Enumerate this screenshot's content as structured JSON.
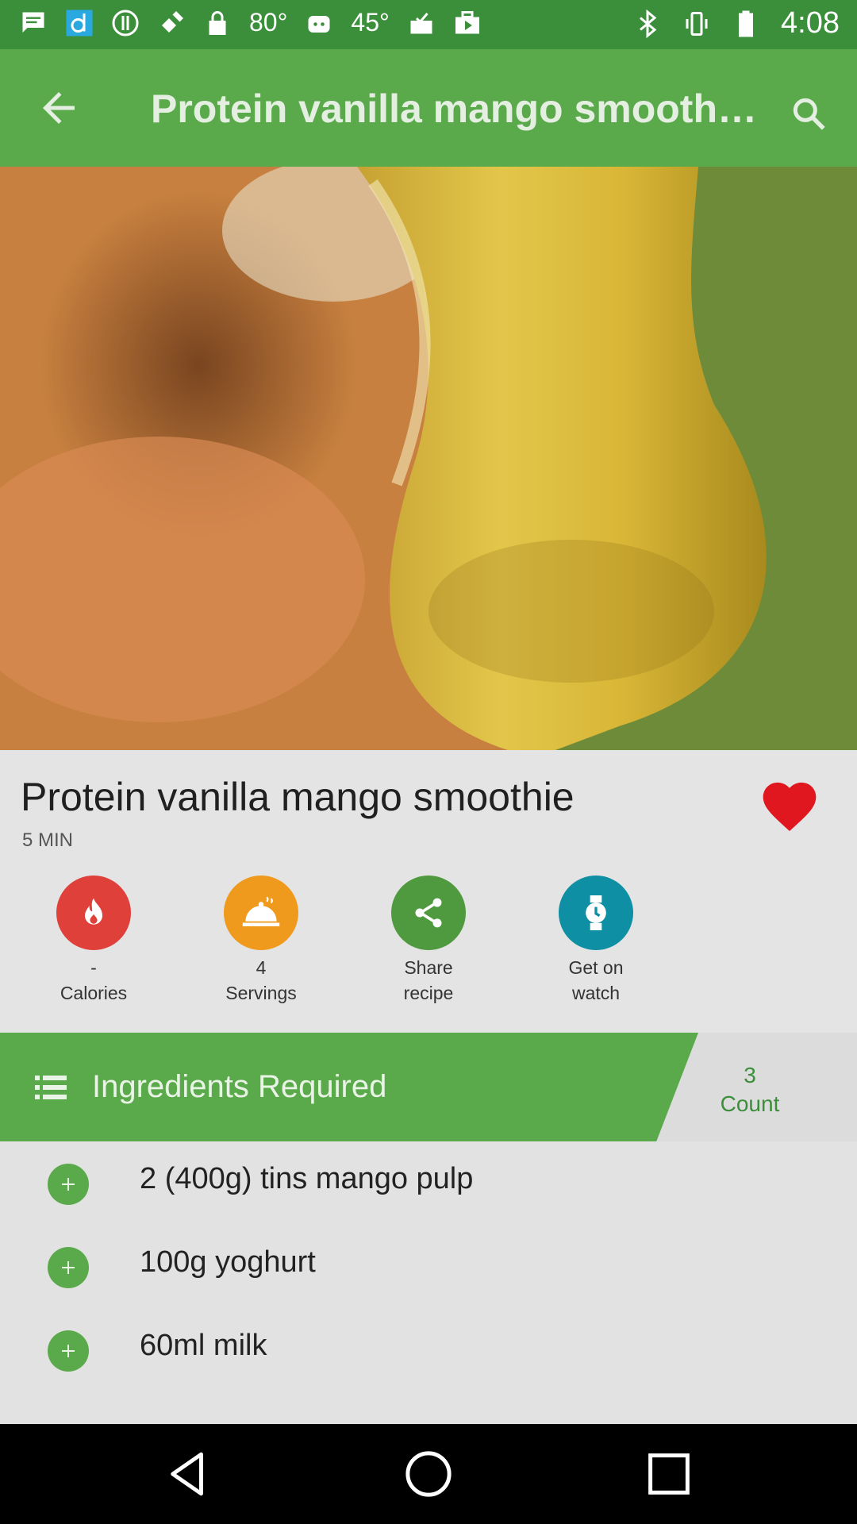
{
  "status_bar": {
    "temp1": "80°",
    "temp2": "45°",
    "time": "4:08"
  },
  "app_bar": {
    "title": "Protein vanilla mango smooth…"
  },
  "recipe": {
    "title": "Protein vanilla mango smoothie",
    "time": "5 MIN",
    "favorite": true
  },
  "actions": [
    {
      "value": "-",
      "label": "Calories",
      "color": "#e0403a",
      "icon": "flame-icon"
    },
    {
      "value": "4",
      "label": "Servings",
      "color": "#ef9a1d",
      "icon": "cloche-icon"
    },
    {
      "value": "Share",
      "label": "recipe",
      "color": "#4f9a3e",
      "icon": "share-icon"
    },
    {
      "value": "Get on",
      "label": "watch",
      "color": "#0e8fa3",
      "icon": "watch-icon"
    }
  ],
  "ingredients": {
    "header": "Ingredients Required",
    "count_value": "3",
    "count_label": "Count",
    "items": [
      "2 (400g) tins mango pulp",
      "100g yoghurt",
      "60ml milk"
    ]
  },
  "colors": {
    "primary": "#5aaa4b",
    "status": "#3b8f3b",
    "heart": "#e0171f"
  }
}
